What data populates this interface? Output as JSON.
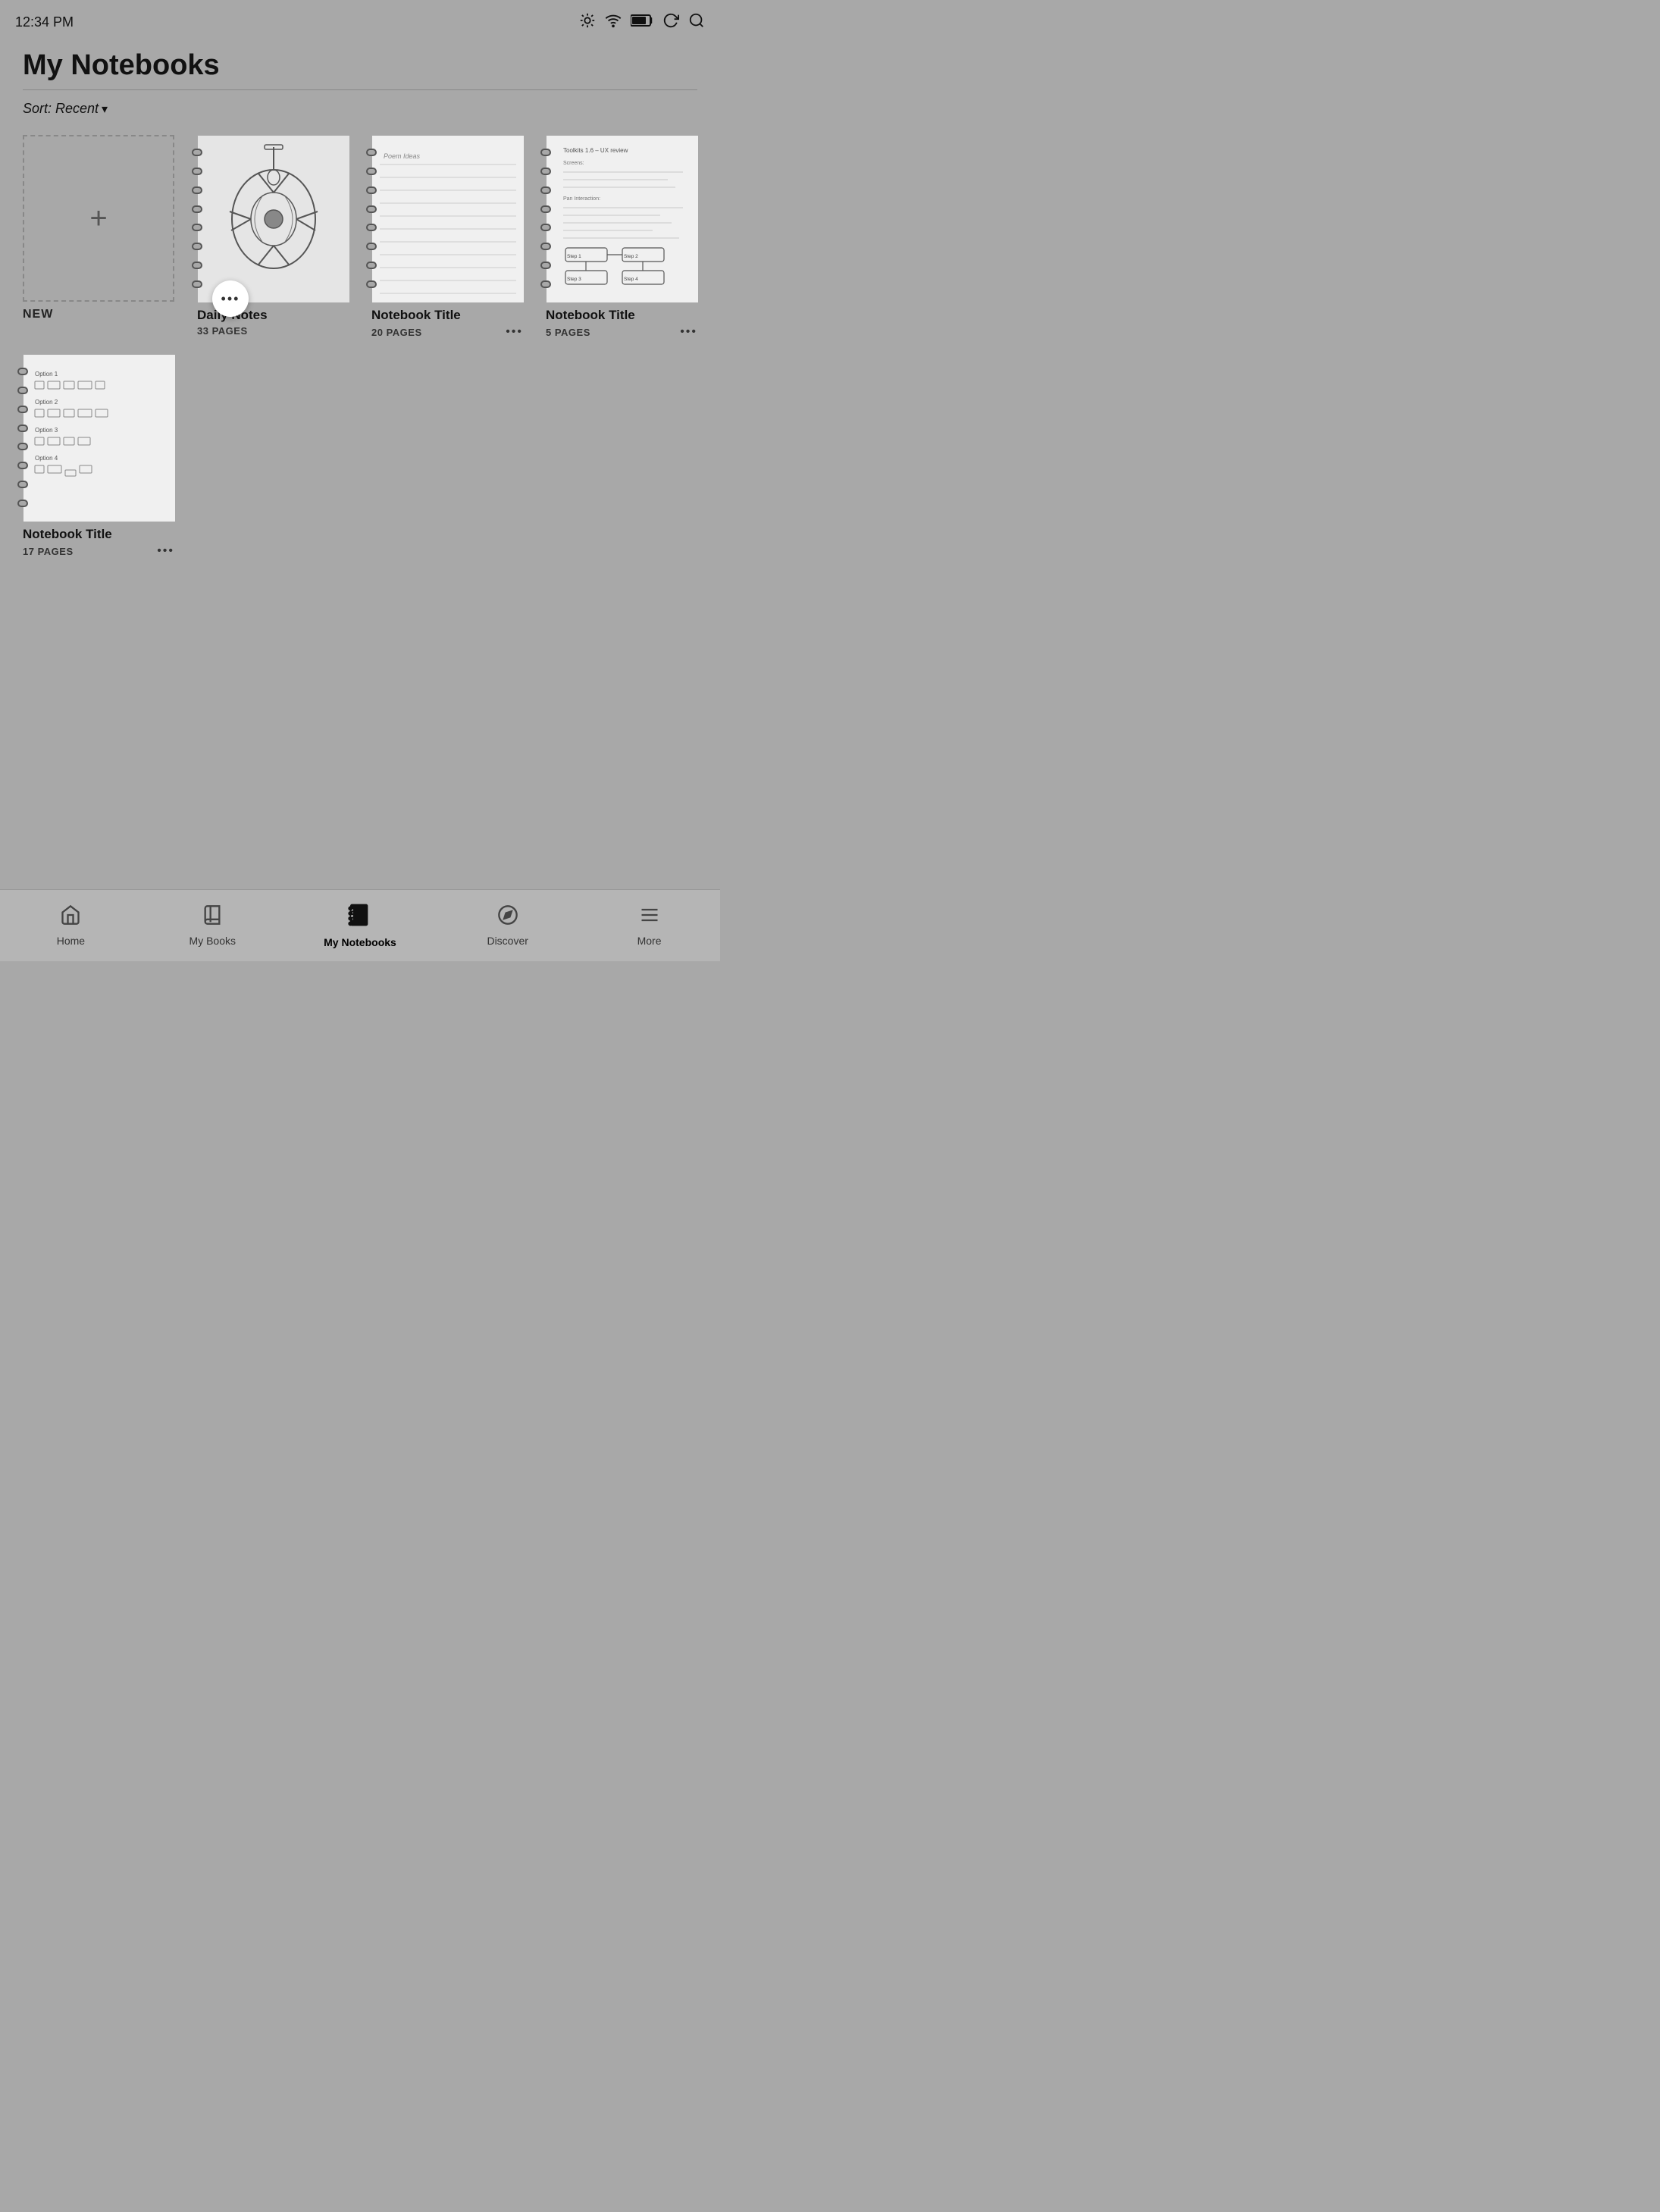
{
  "statusBar": {
    "time": "12:34 PM",
    "icons": [
      "brightness-icon",
      "wifi-icon",
      "battery-icon",
      "sync-icon",
      "search-icon"
    ]
  },
  "header": {
    "title": "My Notebooks"
  },
  "sortBar": {
    "label": "Sort: Recent",
    "chevron": "▾"
  },
  "newNotebook": {
    "label": "NEW"
  },
  "notebooks": [
    {
      "title": "Daily Notes",
      "pages": "33 PAGES",
      "type": "spiral-sketch"
    },
    {
      "title": "Notebook Title",
      "pages": "20 PAGES",
      "type": "spiral-lined"
    },
    {
      "title": "Notebook Title",
      "pages": "5 PAGES",
      "type": "spiral-flowchart"
    },
    {
      "title": "Notebook Title",
      "pages": "17 PAGES",
      "type": "spiral-options"
    }
  ],
  "moreButton": {
    "dots": "•••"
  },
  "bottomNav": [
    {
      "id": "home",
      "label": "Home",
      "icon": "⌂",
      "active": false
    },
    {
      "id": "my-books",
      "label": "My Books",
      "icon": "📚",
      "active": false
    },
    {
      "id": "my-notebooks",
      "label": "My Notebooks",
      "icon": "📓",
      "active": true
    },
    {
      "id": "discover",
      "label": "Discover",
      "icon": "◎",
      "active": false
    },
    {
      "id": "more",
      "label": "More",
      "icon": "☰",
      "active": false
    }
  ]
}
